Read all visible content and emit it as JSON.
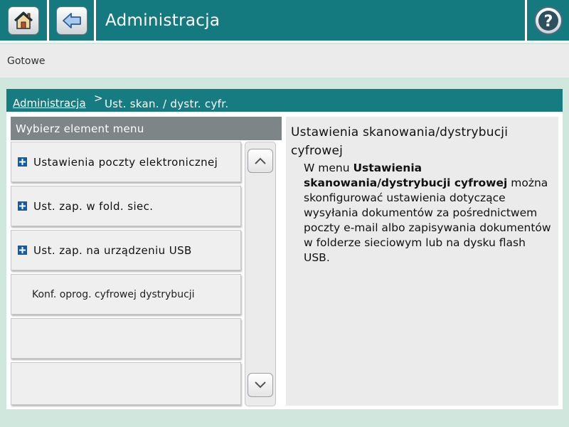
{
  "header": {
    "title": "Administracja",
    "icons": {
      "home": "home-icon",
      "back": "back-arrow-icon",
      "help": "help-icon"
    }
  },
  "status": {
    "text": "Gotowe"
  },
  "breadcrumb": {
    "link": "Administracja",
    "separator": ">",
    "current": "Ust. skan. / dystr. cyfr."
  },
  "menu": {
    "header": "Wybierz element menu",
    "items": [
      {
        "label": "Ustawienia poczty elektronicznej",
        "expandable": true
      },
      {
        "label": "Ust. zap. w fold. siec.",
        "expandable": true
      },
      {
        "label": "Ust. zap. na urządzeniu USB",
        "expandable": true
      },
      {
        "label": "Konf. oprog. cyfrowej dystrybucji",
        "expandable": false
      },
      {
        "label": "",
        "expandable": false
      },
      {
        "label": "",
        "expandable": false
      }
    ]
  },
  "help": {
    "title": "Ustawienia skanowania/dystrybucji cyfrowej",
    "text_pre": "W menu ",
    "text_bold": "Ustawienia skanowania/dystrybucji cyfrowej",
    "text_post": " można skonfigurować ustawienia dotyczące wysyłania dokumentów za pośrednictwem poczty e-mail albo zapisywania dokumentów w folderze sieciowym lub na dysku flash USB."
  },
  "colors": {
    "accent": "#157a80",
    "background": "#cfe7dc",
    "menu_header": "#7d8587",
    "plus_icon": "#0e5da6"
  }
}
